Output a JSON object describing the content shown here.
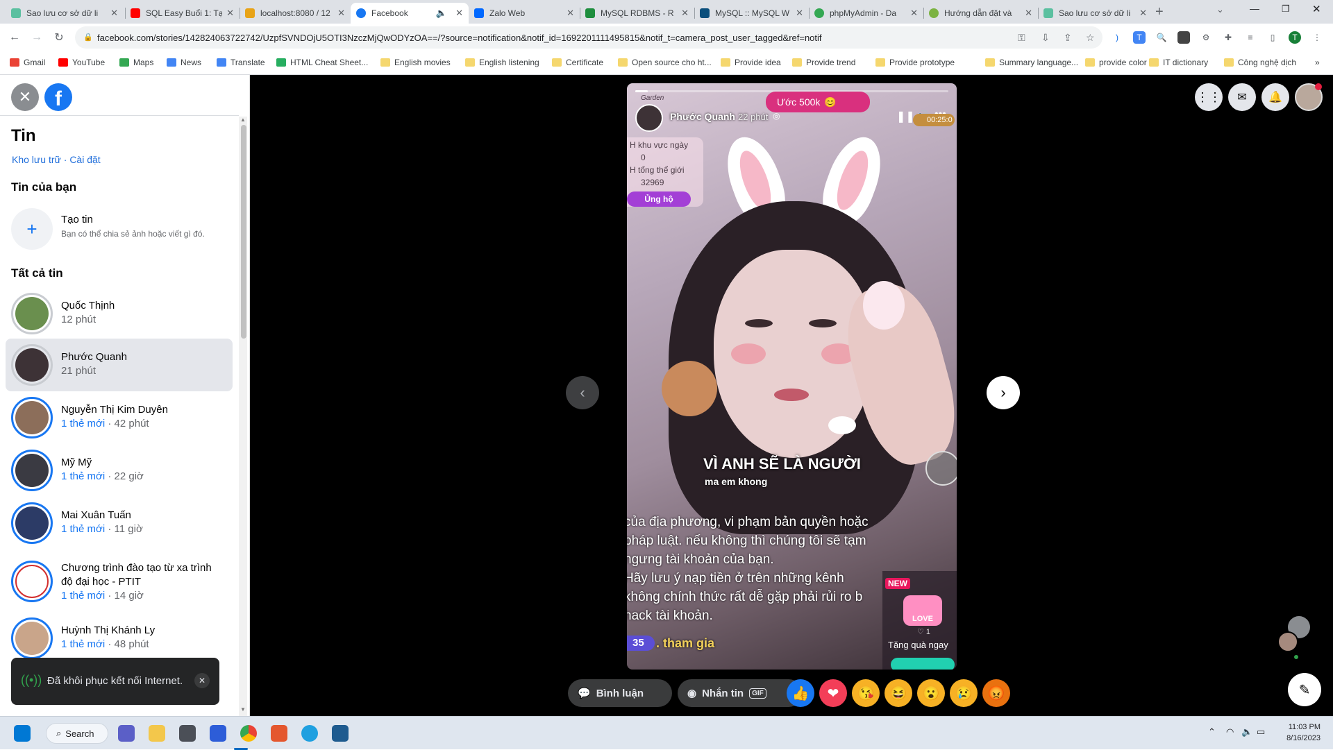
{
  "browser": {
    "tabs": [
      {
        "title": "Sao lưu cơ sở dữ li",
        "color": "#5bc0a0"
      },
      {
        "title": "SQL Easy Buổi 1: Tạ",
        "color": "#ff0000"
      },
      {
        "title": "localhost:8080 / 12",
        "color": "#e8a317"
      },
      {
        "title": "Facebook",
        "color": "#1877f2"
      },
      {
        "title": "Zalo Web",
        "color": "#0068ff"
      },
      {
        "title": "MySQL RDBMS - R",
        "color": "#1e8e3e"
      },
      {
        "title": "MySQL :: MySQL W",
        "color": "#0b4f7c"
      },
      {
        "title": "phpMyAdmin - Da",
        "color": "#34a853"
      },
      {
        "title": "Hướng dẫn đặt và",
        "color": "#7cb342"
      },
      {
        "title": "Sao lưu cơ sở dữ li",
        "color": "#5bc0a0"
      }
    ],
    "new_tab_label": "+",
    "address": "facebook.com/stories/142824063722742/UzpfSVNDOjU5OTI3NzczMjQwODYzOA==/?source=notification&notif_id=1692201111495815&notif_t=camera_post_user_tagged&ref=notif",
    "profile_initial": "T",
    "bookmarks": [
      {
        "label": "Gmail",
        "color": "#ea4335"
      },
      {
        "label": "YouTube",
        "color": "#ff0000"
      },
      {
        "label": "Maps",
        "color": "#34a853"
      },
      {
        "label": "News",
        "color": "#4285f4"
      },
      {
        "label": "Translate",
        "color": "#4285f4"
      },
      {
        "label": "HTML Cheat Sheet...",
        "color": "#27ae60"
      },
      {
        "label": "English movies",
        "color": "#f5d76e"
      },
      {
        "label": "English listening",
        "color": "#f5d76e"
      },
      {
        "label": "Certificate",
        "color": "#f5d76e"
      },
      {
        "label": "Open source cho ht...",
        "color": "#f5d76e"
      },
      {
        "label": "Provide idea",
        "color": "#f5d76e"
      },
      {
        "label": "Provide trend",
        "color": "#f5d76e"
      },
      {
        "label": "Provide prototype",
        "color": "#f5d76e"
      },
      {
        "label": "Summary language...",
        "color": "#f5d76e"
      },
      {
        "label": "provide color",
        "color": "#f5d76e"
      },
      {
        "label": "IT dictionary",
        "color": "#f5d76e"
      },
      {
        "label": "Công nghệ dịch",
        "color": "#f5d76e"
      }
    ],
    "more_bookmarks": "»"
  },
  "sidebar": {
    "heading": "Tin",
    "links": "Kho lưu trữ · Cài đặt",
    "your_story_heading": "Tin của bạn",
    "create_title": "Tạo tin",
    "create_sub": "Bạn có thể chia sẻ ảnh hoặc viết gì đó.",
    "all_stories_heading": "Tất cả tin",
    "stories": [
      {
        "name": "Quốc Thịnh",
        "new": "",
        "time": "12 phút",
        "avatar": "#6a8f4e"
      },
      {
        "name": "Phước Quanh",
        "new": "",
        "time": "21 phút",
        "avatar": "#3d3236"
      },
      {
        "name": "Nguyễn Thị Kim Duyên",
        "new": "1 thẻ mới",
        "time": " · 42 phút",
        "avatar": "#8c6e5a"
      },
      {
        "name": "Mỹ Mỹ",
        "new": "1 thẻ mới",
        "time": " · 22 giờ",
        "avatar": "#3a3a42"
      },
      {
        "name": "Mai Xuân Tuấn",
        "new": "1 thẻ mới",
        "time": " · 11 giờ",
        "avatar": "#2c3b66"
      },
      {
        "name": "Chương trình đào tạo từ xa trình",
        "name2": "độ đại học - PTIT",
        "new": "1 thẻ mới",
        "time": " · 14 giờ",
        "avatar": "#ffffff"
      },
      {
        "name": "Huỳnh Thị Khánh Ly",
        "new": "1 thẻ mới",
        "time": " · 48 phút",
        "avatar": "#c9a58a"
      }
    ],
    "toast": "Đã khôi phục kết nối Internet."
  },
  "viewer": {
    "author": "Phước Quanh",
    "time": "22 phút",
    "overlay_top": "Ước 500k",
    "timer": "00:25:0",
    "rank1": "H khu vực ngày",
    "rank1_val": "0",
    "rank2": "H tổng thể giới",
    "rank2_val": "32969",
    "support_btn": "Ủng hộ",
    "garden": "Garden",
    "caption_big": "VÌ ANH SẼ LÀ NGƯỜI",
    "caption_small": "ma em khong",
    "notice_lines": [
      "của địa phương, vi phạm bản quyền hoặc",
      "pháp luật. nếu không thì chúng tôi sẽ tạm",
      "ngưng tài khoản của bạn.",
      "Hãy lưu ý nạp tiền ở trên những kênh",
      "không chính thức rất dễ gặp phải rủi ro b",
      "hack tài khoản."
    ],
    "join_count": "35",
    "join_text": ". tham gia",
    "gift_new": "NEW",
    "gift_love": "LOVE",
    "gift_likes": "1",
    "gift_text": "Tặng quà ngay",
    "comment_btn": "Bình luận",
    "message_btn": "Nhắn tin",
    "gif_label": "GIF",
    "reactions": [
      {
        "name": "like",
        "color": "#1877f2",
        "glyph": "👍"
      },
      {
        "name": "love",
        "color": "#f33e58",
        "glyph": "❤"
      },
      {
        "name": "care",
        "color": "#f7b125",
        "glyph": "😘"
      },
      {
        "name": "haha",
        "color": "#f7b125",
        "glyph": "😆"
      },
      {
        "name": "wow",
        "color": "#f7b125",
        "glyph": "😮"
      },
      {
        "name": "sad",
        "color": "#f7b125",
        "glyph": "😢"
      },
      {
        "name": "angry",
        "color": "#e9710f",
        "glyph": "😡"
      }
    ]
  },
  "taskbar": {
    "search": "Search",
    "time": "11:03 PM",
    "date": "8/16/2023"
  }
}
